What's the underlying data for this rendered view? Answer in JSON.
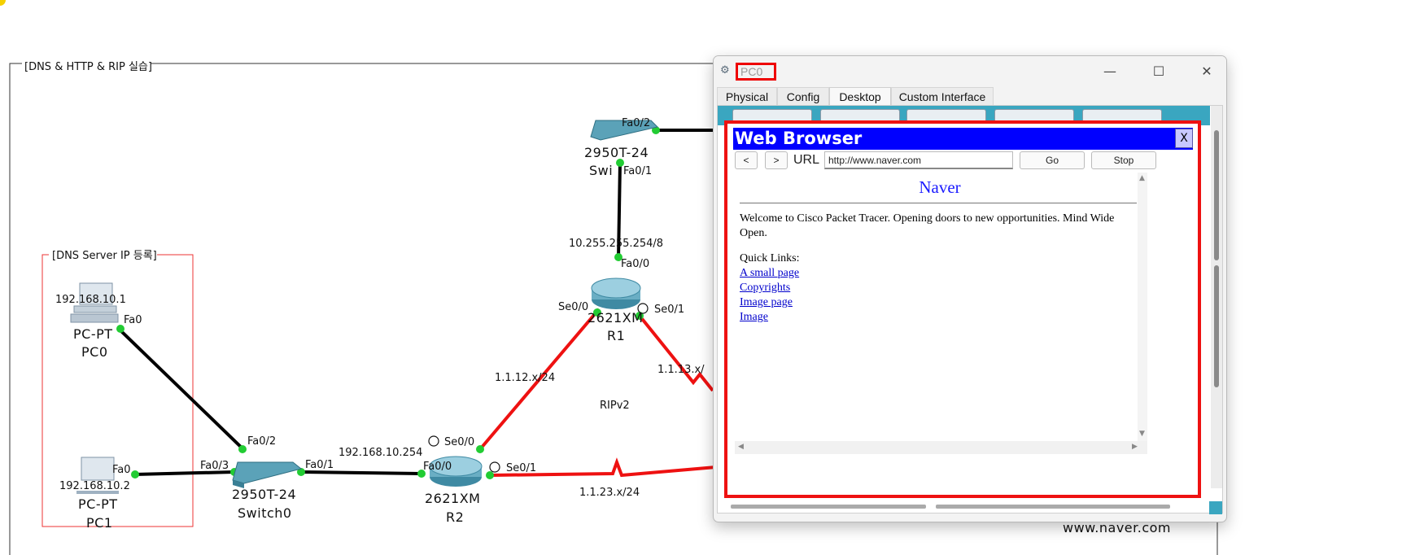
{
  "topology": {
    "outer_area_label": "[DNS & HTTP & RIP 실습]",
    "dns_area_label": "[DNS Server IP 등록]",
    "rip_label": "RIPv2",
    "footer_url": "www.naver.com",
    "devices": {
      "pc0": {
        "ip": "192.168.10.1",
        "model": "PC-PT",
        "name": "PC0",
        "port": "Fa0"
      },
      "pc1": {
        "ip": "192.168.10.2",
        "model": "PC-PT",
        "name": "PC1",
        "port": "Fa0"
      },
      "switch0": {
        "model": "2950T-24",
        "name": "Switch0",
        "ports": [
          "Fa0/2",
          "Fa0/3",
          "Fa0/1"
        ]
      },
      "r2": {
        "model": "2621XM",
        "name": "R2",
        "ports": [
          "Fa0/0",
          "Se0/0",
          "Se0/1"
        ],
        "lan_ip": "192.168.10.254"
      },
      "r1": {
        "model": "2621XM",
        "name": "R1",
        "ports": [
          "Fa0/0",
          "Se0/0",
          "Se0/1"
        ]
      },
      "switch_top": {
        "model": "2950T-24",
        "name": "Swi",
        "ports": [
          "Fa0/2",
          "Fa0/1"
        ]
      }
    },
    "networks": {
      "r1_r2": "1.1.12.x/24",
      "r1_r3": "1.1.13.x/",
      "r2_r3": "1.1.23.x/24",
      "r1_lan": "10.255.255.254/8"
    }
  },
  "window": {
    "title": "PC0",
    "tabs": [
      "Physical",
      "Config",
      "Desktop",
      "Custom Interface"
    ],
    "active_tab": "Desktop",
    "controls": {
      "minimize": "—",
      "maximize": "☐",
      "close": "✕"
    }
  },
  "browser": {
    "header": "Web Browser",
    "close_label": "X",
    "back_label": "<",
    "forward_label": ">",
    "url_label": "URL",
    "url_value": "http://www.naver.com",
    "go_label": "Go",
    "stop_label": "Stop",
    "page": {
      "title": "Naver",
      "body": "Welcome to Cisco Packet Tracer. Opening doors to new opportunities. Mind Wide Open.",
      "links_title": "Quick Links:",
      "links": [
        "A small page",
        "Copyrights",
        "Image page",
        "Image"
      ]
    }
  },
  "colors": {
    "link_red": "#ee1111",
    "browser_blue": "#0000ff",
    "desktop_teal": "#3aa6c0",
    "port_green": "#22cc33"
  }
}
